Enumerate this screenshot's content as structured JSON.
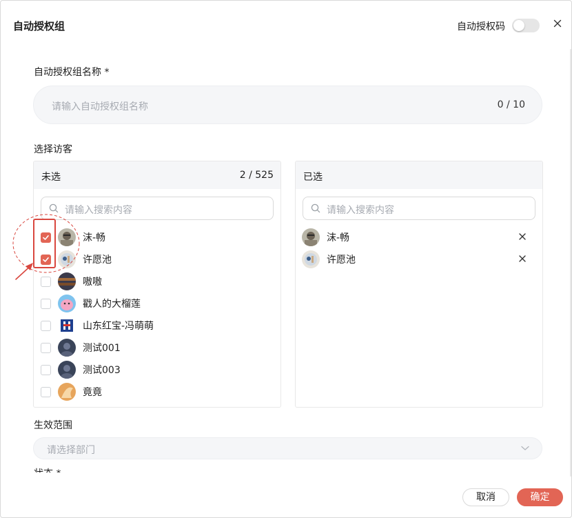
{
  "dialog": {
    "title": "自动授权组",
    "auth_code_label": "自动授权码",
    "auth_code_enabled": false
  },
  "name_field": {
    "label": "自动授权组名称 *",
    "placeholder": "请输入自动授权组名称",
    "counter": "0 / 10"
  },
  "visitors": {
    "label": "选择访客",
    "unselected": {
      "title": "未选",
      "count": "2 / 525",
      "search_placeholder": "请输入搜索内容",
      "items": [
        {
          "name": "沫-畅",
          "checked": true
        },
        {
          "name": "许愿池",
          "checked": true
        },
        {
          "name": "嗷嗷",
          "checked": false
        },
        {
          "name": "戳人的大榴莲",
          "checked": false
        },
        {
          "name": "山东红宝-冯萌萌",
          "checked": false
        },
        {
          "name": "测试001",
          "checked": false
        },
        {
          "name": "测试003",
          "checked": false
        },
        {
          "name": "竟竟",
          "checked": false
        }
      ]
    },
    "selected": {
      "title": "已选",
      "search_placeholder": "请输入搜索内容",
      "items": [
        {
          "name": "沫-畅"
        },
        {
          "name": "许愿池"
        }
      ]
    }
  },
  "scope": {
    "label": "生效范围",
    "placeholder": "请选择部门"
  },
  "status": {
    "label": "状态 *"
  },
  "footer": {
    "cancel_label": "取消",
    "ok_label": "确定"
  },
  "colors": {
    "accent": "#e26555",
    "annotation": "#d9463e"
  }
}
